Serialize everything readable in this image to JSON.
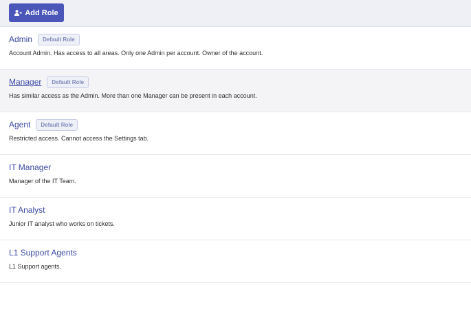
{
  "toolbar": {
    "add_role_label": "Add Role",
    "add_role_icon": "users-plus-icon"
  },
  "colors": {
    "primary": "#4a56b8",
    "link": "#3d4aa6",
    "badge_text": "#7f8ab8",
    "hover_row": "#f4f4f6"
  },
  "roles": [
    {
      "name": "Admin",
      "badge": "Default Role",
      "description": "Account Admin. Has access to all areas. Only one Admin per account. Owner of the account."
    },
    {
      "name": "Manager",
      "badge": "Default Role",
      "description": "Has similar access as the Admin. More than one Manager can be present in each account."
    },
    {
      "name": "Agent",
      "badge": "Default Role",
      "description": "Restricted access. Cannot access the Settings tab."
    },
    {
      "name": "IT Manager",
      "description": "Manager of the IT Team."
    },
    {
      "name": "IT Analyst",
      "description": "Junior IT analyst who works on tickets."
    },
    {
      "name": "L1 Support Agents",
      "description": "L1 Support agents."
    }
  ]
}
